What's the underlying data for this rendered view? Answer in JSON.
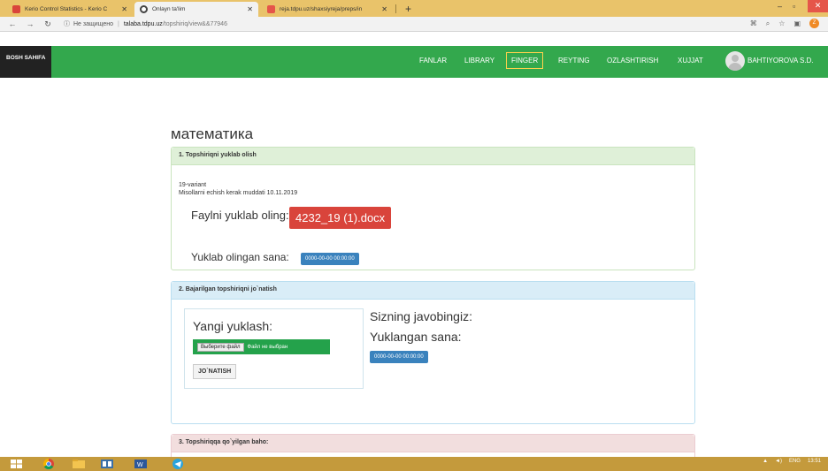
{
  "browser": {
    "tabs": [
      {
        "title": "Kerio Control Statistics - Kerio C",
        "favicon_color": "#d9443b"
      },
      {
        "title": "Onlayn ta'lim",
        "favicon_color": "#444444"
      },
      {
        "title": "reja.tdpu.uz/shaxsiyreja/preps/in",
        "favicon_color": "#e5554a"
      }
    ],
    "newtab": "+",
    "url_warning": "Не защищено",
    "url_host": "talaba.tdpu.uz",
    "url_path": "/topshiriq/view&&77946"
  },
  "navbar": {
    "brand": "BOSH SAHIFA",
    "items": [
      "FANLAR",
      "LIBRARY",
      "FINGER",
      "REYTING",
      "OZLASHTIRISH",
      "XUJJAT"
    ],
    "active": "FINGER",
    "user": "BAHTIYOROVA S.D.",
    "color": "#33a84d"
  },
  "page": {
    "title": "математика"
  },
  "panel1": {
    "heading": "1. Topshiriqni yuklab olish",
    "variant": "19-variant",
    "deadline": "Misollarni echish kerak muddati 10.11.2019",
    "download_label": "Faylni yuklab oling:",
    "file_name": "4232_19 (1).docx",
    "date_label": "Yuklab olingan sana:",
    "date_value": "0000-00-00 00:00:00"
  },
  "panel2": {
    "heading": "2. Bajarilgan topshiriqni jo`natish",
    "upload_title": "Yangi yuklash:",
    "choose_file": "Выберите файл",
    "file_status": "Файл не выбран",
    "submit": "JO`NATISH",
    "answer_label": "Sizning javobingiz:",
    "uploaded_label": "Yuklangan sana:",
    "uploaded_date": "0000-00-00 00:00:00"
  },
  "panel3": {
    "heading": "3. Topshiriqqa qo`yilgan baho:"
  },
  "taskbar": {
    "lang": "ENG",
    "time": "13:51"
  }
}
